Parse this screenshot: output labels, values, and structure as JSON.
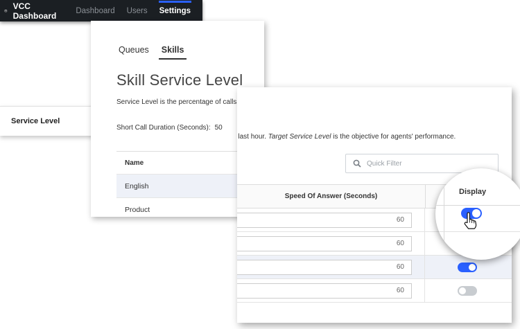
{
  "topbar": {
    "brand": "VCC Dashboard",
    "nav": [
      "Dashboard",
      "Users",
      "Settings"
    ],
    "active": "Settings",
    "logo_icon": "database-icon"
  },
  "sidebar": {
    "item_label": "Service Level"
  },
  "skills_card": {
    "tabs": [
      "Queues",
      "Skills"
    ],
    "active_tab": "Skills",
    "title": "Skill Service Level",
    "description": "Service Level is the percentage of calls",
    "short_call_label": "Short Call Duration (Seconds):",
    "short_call_value": "50",
    "table": {
      "header": "Name",
      "rows": [
        "English",
        "Product"
      ]
    }
  },
  "zoom_card": {
    "description_plain": "ver the last hour. ",
    "description_italic": "Target Service Level",
    "description_tail": " is the objective for agents' performance.",
    "filter_placeholder": "Quick Filter",
    "columns": {
      "speed": "Speed Of Answer (Seconds)",
      "display": "Display"
    },
    "rows": [
      {
        "speed": "60",
        "display": true
      },
      {
        "speed": "60",
        "display": false
      },
      {
        "speed": "60",
        "display": true
      },
      {
        "speed": "60",
        "display": false
      }
    ]
  },
  "colors": {
    "accent": "#2a60ff",
    "toggle_off": "#c8ccd0",
    "row_shade": "#eef1f8",
    "topbar_bg": "#1b1f23"
  }
}
